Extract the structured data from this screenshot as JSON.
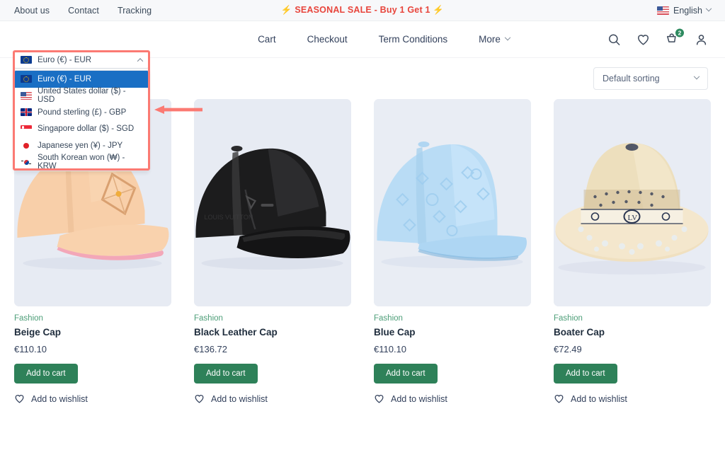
{
  "topbar": {
    "links": [
      {
        "label": "About us"
      },
      {
        "label": "Contact"
      },
      {
        "label": "Tracking"
      }
    ],
    "promo": "SEASONAL SALE - Buy 1 Get 1",
    "promo_bolt": "⚡",
    "language": "English"
  },
  "header": {
    "nav": [
      {
        "label": "Cart",
        "has_chevron": false
      },
      {
        "label": "Checkout",
        "has_chevron": false
      },
      {
        "label": "Term Conditions",
        "has_chevron": false
      },
      {
        "label": "More",
        "has_chevron": true
      }
    ],
    "icons": [
      {
        "name": "search-icon"
      },
      {
        "name": "wishlist-heart-icon"
      },
      {
        "name": "cart-icon"
      },
      {
        "name": "account-icon"
      }
    ],
    "cart_count": "2"
  },
  "currency": {
    "selected": "Euro (€) - EUR",
    "expanded": true,
    "options": [
      {
        "label": "Euro (€) - EUR",
        "flag": "eu",
        "selected": true
      },
      {
        "label": "United States dollar ($) - USD",
        "flag": "us",
        "selected": false
      },
      {
        "label": "Pound sterling (£) - GBP",
        "flag": "gb",
        "selected": false
      },
      {
        "label": "Singapore dollar ($) - SGD",
        "flag": "sg",
        "selected": false
      },
      {
        "label": "Japanese yen (¥) - JPY",
        "flag": "jp",
        "selected": false
      },
      {
        "label": "South Korean won (₩) - KRW",
        "flag": "kr",
        "selected": false
      }
    ]
  },
  "annotation": {
    "box_color": "#fb7a73",
    "arrow_color": "#fb7a73",
    "arrow_direction": "left"
  },
  "sorting": {
    "selected": "Default sorting"
  },
  "products": [
    {
      "category": "Fashion",
      "name": "Beige Cap",
      "price": "€110.10",
      "add_to_cart": "Add to cart",
      "wishlist": "Add to wishlist",
      "image": "beige-cap",
      "image_bg": "#e7ebf3"
    },
    {
      "category": "Fashion",
      "name": "Black Leather Cap",
      "price": "€136.72",
      "add_to_cart": "Add to cart",
      "wishlist": "Add to wishlist",
      "image": "black-leather-cap",
      "image_bg": "#e7ebf3"
    },
    {
      "category": "Fashion",
      "name": "Blue Cap",
      "price": "€110.10",
      "add_to_cart": "Add to cart",
      "wishlist": "Add to wishlist",
      "image": "blue-cap",
      "image_bg": "#e7ebf3"
    },
    {
      "category": "Fashion",
      "name": "Boater Cap",
      "price": "€72.49",
      "add_to_cart": "Add to cart",
      "wishlist": "Add to wishlist",
      "image": "boater-cap",
      "image_bg": "#e7ebf3"
    }
  ],
  "colors": {
    "accent_green": "#2e8159",
    "category_green": "#4d9e78",
    "promo_red": "#e8453c",
    "select_blue": "#1a6fc4",
    "text_dark": "#1f2d3d"
  }
}
